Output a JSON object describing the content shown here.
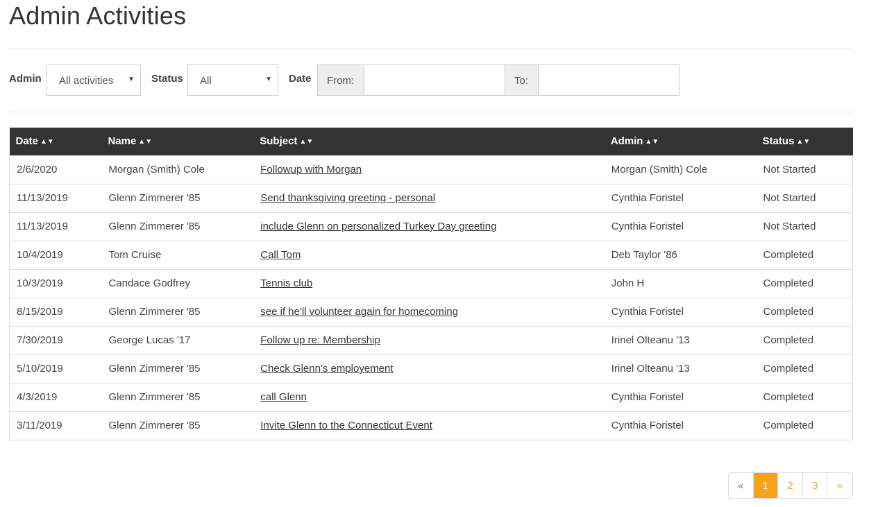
{
  "page": {
    "title": "Admin Activities"
  },
  "filters": {
    "admin": {
      "label": "Admin",
      "selected": "All activities"
    },
    "status": {
      "label": "Status",
      "selected": "All"
    },
    "date": {
      "label": "Date",
      "from_label": "From:",
      "to_label": "To:",
      "from_value": "",
      "to_value": ""
    }
  },
  "table": {
    "headers": {
      "date": "Date",
      "name": "Name",
      "subject": "Subject",
      "admin": "Admin",
      "status": "Status"
    },
    "rows": [
      {
        "date": "2/6/2020",
        "name": "Morgan (Smith) Cole",
        "subject": "Followup with Morgan",
        "admin": "Morgan (Smith) Cole",
        "status": "Not Started"
      },
      {
        "date": "11/13/2019",
        "name": "Glenn Zimmerer '85",
        "subject": "Send thanksgiving greeting - personal",
        "admin": "Cynthia Foristel",
        "status": "Not Started"
      },
      {
        "date": "11/13/2019",
        "name": "Glenn Zimmerer '85",
        "subject": "include Glenn on personalized Turkey Day greeting",
        "admin": "Cynthia Foristel",
        "status": "Not Started"
      },
      {
        "date": "10/4/2019",
        "name": "Tom Cruise",
        "subject": "Call Tom",
        "admin": "Deb Taylor '86",
        "status": "Completed"
      },
      {
        "date": "10/3/2019",
        "name": "Candace Godfrey",
        "subject": "Tennis club",
        "admin": "John H",
        "status": "Completed"
      },
      {
        "date": "8/15/2019",
        "name": "Glenn Zimmerer '85",
        "subject": "see if he'll volunteer again for homecoming",
        "admin": "Cynthia Foristel",
        "status": "Completed"
      },
      {
        "date": "7/30/2019",
        "name": "George Lucas '17",
        "subject": "Follow up re: Membership",
        "admin": "Irinel Olteanu '13",
        "status": "Completed"
      },
      {
        "date": "5/10/2019",
        "name": "Glenn Zimmerer '85",
        "subject": "Check Glenn's employement",
        "admin": "Irinel Olteanu '13",
        "status": "Completed"
      },
      {
        "date": "4/3/2019",
        "name": "Glenn Zimmerer '85",
        "subject": "call Glenn",
        "admin": "Cynthia Foristel",
        "status": "Completed"
      },
      {
        "date": "3/11/2019",
        "name": "Glenn Zimmerer '85",
        "subject": "Invite Glenn to the Connecticut Event",
        "admin": "Cynthia Foristel",
        "status": "Completed"
      }
    ]
  },
  "pagination": {
    "prev": "«",
    "pages": [
      "1",
      "2",
      "3"
    ],
    "current": "1",
    "next": "»"
  },
  "colors": {
    "accent": "#f7a21b",
    "header_bg": "#333333"
  }
}
